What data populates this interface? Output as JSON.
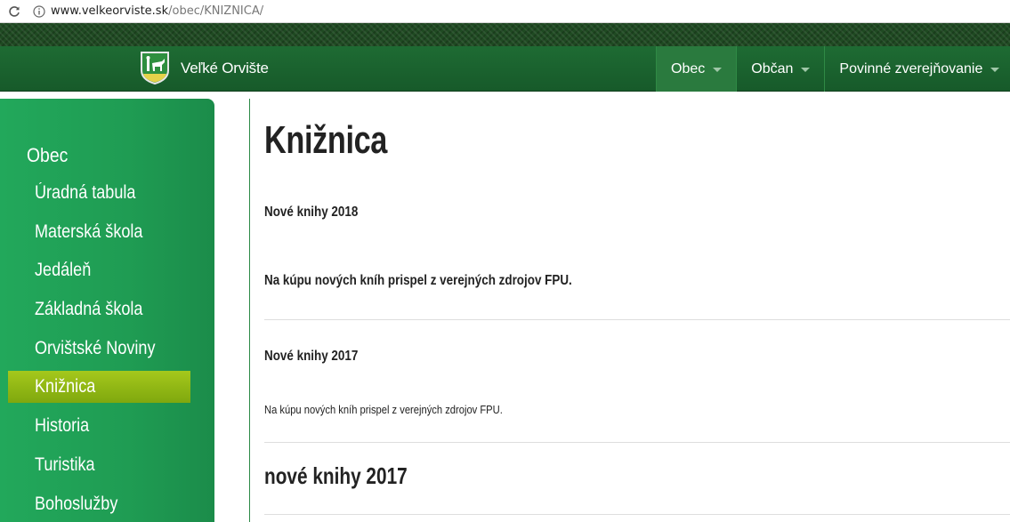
{
  "browser": {
    "url_host": "www.velkeorviste.sk",
    "url_path": "/obec/KNIZNICA/"
  },
  "header": {
    "site_name": "Veľké Orvište",
    "nav": [
      {
        "label": "Obec",
        "active": true
      },
      {
        "label": "Občan",
        "active": false
      },
      {
        "label": "Povinné zverejňovanie",
        "active": false
      }
    ]
  },
  "sidebar": {
    "heading": "Obec",
    "items": [
      {
        "label": "Úradná tabula"
      },
      {
        "label": "Materská škola"
      },
      {
        "label": "Jedáleň"
      },
      {
        "label": "Základná škola"
      },
      {
        "label": "Orvištské Noviny"
      },
      {
        "label": "Knižnica",
        "active": true
      },
      {
        "label": "Historia"
      },
      {
        "label": "Turistika"
      },
      {
        "label": "Bohoslužby"
      }
    ]
  },
  "main": {
    "title": "Knižnica",
    "section1_heading": "Nové knihy 2018",
    "section1_text": "Na kúpu nových kníh prispel z verejných zdrojov FPU.",
    "section2_heading": "Nové knihy 2017",
    "section2_text": "Na kúpu nových kníh prispel z verejných zdrojov FPU.",
    "section3_heading": "nové knihy 2017"
  },
  "colors": {
    "nav_green": "#1e6b33",
    "sidebar_green": "#22a85b",
    "active_item": "#9cc31a"
  }
}
